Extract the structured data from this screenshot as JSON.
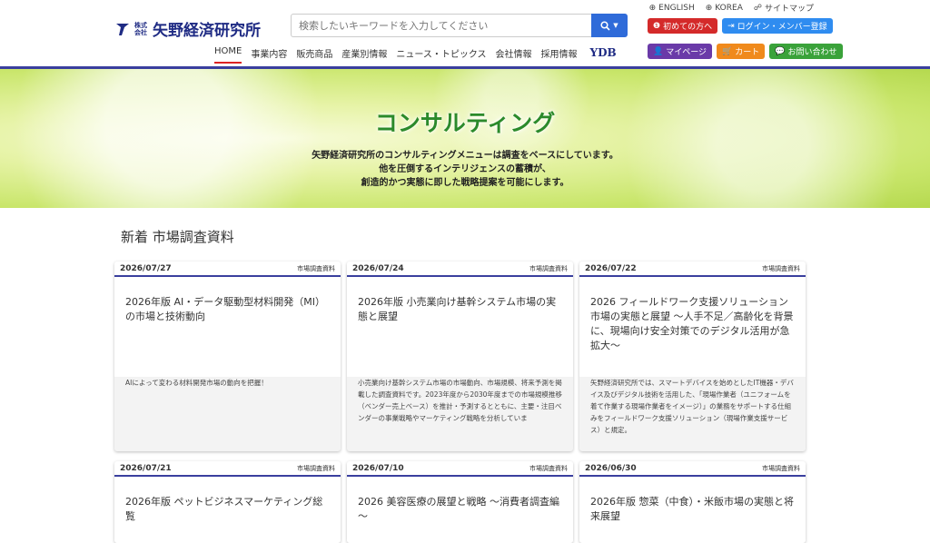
{
  "header": {
    "logo_small": "株式会社",
    "logo_text": "矢野経済研究所",
    "search_placeholder": "検索したいキーワードを入力してください",
    "top_links": [
      "ENGLISH",
      "KOREA",
      "サイトマップ"
    ],
    "first_visit": "初めての方へ",
    "login": "ログイン・メンバー登録",
    "mypage": "マイページ",
    "cart": "カート",
    "contact": "お問い合わせ",
    "nav": [
      "HOME",
      "事業内容",
      "販売商品",
      "産業別情報",
      "ニュース・トピックス",
      "会社情報",
      "採用情報"
    ],
    "ydb": "YDB",
    "colors": {
      "navy": "#1f2b84",
      "search_btn": "#2f6bd9",
      "first_visit": "#d42a2a",
      "login": "#2f8cf0",
      "mypage": "#6a3aa8",
      "cart": "#f08a1c",
      "contact": "#3aa23a"
    }
  },
  "hero": {
    "title": "コンサルティング",
    "lines": [
      "矢野経済研究所のコンサルティングメニューは調査をベースにしています。",
      "他を圧倒するインテリジェンスの蓄積が、",
      "創造的かつ実態に即した戦略提案を可能にします。"
    ]
  },
  "section": {
    "title": "新着 市場調査資料",
    "cards": [
      {
        "date": "2026/07/27",
        "category": "市場調査資料",
        "title": "2026年版 AI・データ駆動型材料開発（MI）の市場と技術動向",
        "desc": "AIによって変わる材料開発市場の動向を把握！"
      },
      {
        "date": "2026/07/24",
        "category": "市場調査資料",
        "title": "2026年版 小売業向け基幹システム市場の実態と展望",
        "desc": "小売業向け基幹システム市場の市場動向、市場規模、将来予測を掲載した調査資料です。2023年度から2030年度までの市場規模推移（ベンダー売上ベース）を推計・予測するとともに、主要・注目ベンダーの事業戦略やマーケティング戦略を分析していま"
      },
      {
        "date": "2026/07/22",
        "category": "市場調査資料",
        "title": "2026 フィールドワーク支援ソリューション市場の実態と展望 ～人手不足／高齢化を背景に、現場向け安全対策でのデジタル活用が急拡大～",
        "desc": "矢野経済研究所では、スマートデバイスを始めとしたIT機器・デバイス及びデジタル技術を活用した、「現場作業者（ユニフォームを着て作業する現場作業者をイメージ）」の業務をサポートする仕組みをフィールドワーク支援ソリューション（現場作業支援サービス）と規定。"
      },
      {
        "date": "2026/07/21",
        "category": "市場調査資料",
        "title": "2026年版 ペットビジネスマーケティング総覧",
        "desc": ""
      },
      {
        "date": "2026/07/10",
        "category": "市場調査資料",
        "title": "2026 美容医療の展望と戦略 ～消費者調査編～",
        "desc": ""
      },
      {
        "date": "2026/06/30",
        "category": "市場調査資料",
        "title": "2026年版 惣菜（中食）・米飯市場の実態と将来展望",
        "desc": ""
      }
    ]
  }
}
